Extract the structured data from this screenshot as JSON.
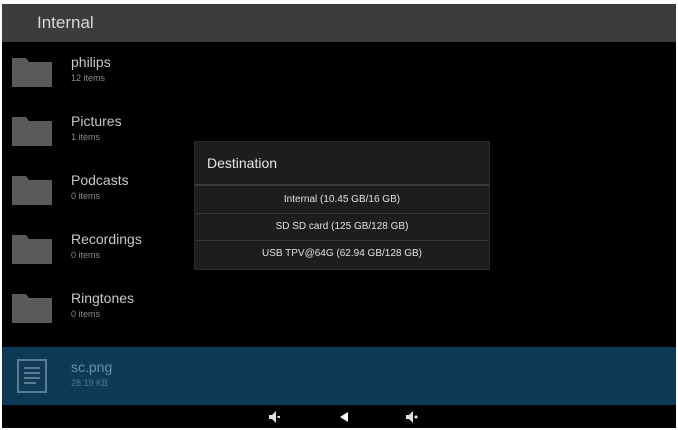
{
  "app_bar": {
    "title": "Internal"
  },
  "files": [
    {
      "name": "philips",
      "meta": "12 items",
      "icon": "folder-icon",
      "selected": false
    },
    {
      "name": "Pictures",
      "meta": "1 items",
      "icon": "folder-icon",
      "selected": false
    },
    {
      "name": "Podcasts",
      "meta": "0 items",
      "icon": "folder-icon",
      "selected": false
    },
    {
      "name": "Recordings",
      "meta": "0 items",
      "icon": "folder-icon",
      "selected": false
    },
    {
      "name": "Ringtones",
      "meta": "0 items",
      "icon": "folder-icon",
      "selected": false
    },
    {
      "name": "sc.png",
      "meta": "28.19 KB",
      "icon": "document-icon",
      "selected": true
    }
  ],
  "dialog": {
    "title": "Destination",
    "options": [
      {
        "label": "Internal (10.45 GB/16 GB)"
      },
      {
        "label": "SD SD card (125 GB/128 GB)"
      },
      {
        "label": "USB TPV@64G (62.94 GB/128 GB)"
      }
    ]
  },
  "nav_bar": {
    "buttons": [
      "volume-down-icon",
      "back-icon",
      "volume-up-icon"
    ]
  },
  "colors": {
    "app_bar": "#3c3c3c",
    "background": "#000000",
    "selected_row": "#0f3a57",
    "folder": "#5a5a5a",
    "dialog": "#1d1d1d"
  }
}
